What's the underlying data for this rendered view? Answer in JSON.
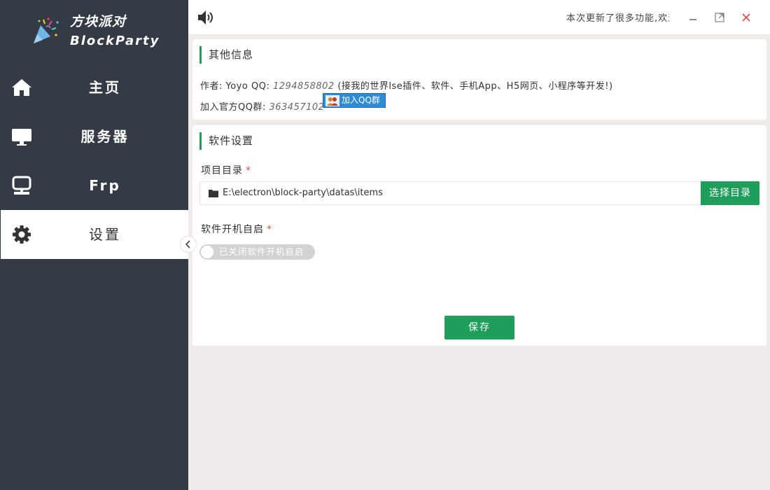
{
  "app": {
    "logo_cn": "方块派对",
    "logo_en": "BlockParty"
  },
  "sidebar": {
    "items": [
      {
        "label": "主页",
        "icon": "home-icon"
      },
      {
        "label": "服务器",
        "icon": "monitor-icon"
      },
      {
        "label": "Frp",
        "icon": "computer-icon"
      },
      {
        "label": "设置",
        "icon": "gear-icon",
        "active": true
      }
    ]
  },
  "topbar": {
    "marquee": "本次更新了很多功能,欢迎"
  },
  "info": {
    "title": "其他信息",
    "author_label": "作者: ",
    "author_name": "Yoyo",
    "qq_label": "QQ: ",
    "qq_number": "1294858802",
    "note": "(接我的世界lse插件、软件、手机App、H5网页、小程序等开发!)",
    "group_label": "加入官方QQ群: ",
    "group_number": "363457102",
    "join_button": "加入QQ群"
  },
  "settings": {
    "title": "软件设置",
    "dir_label": "项目目录",
    "dir_value": "E:\\electron\\block-party\\datas\\items",
    "choose_button": "选择目录",
    "autostart_label": "软件开机自启",
    "autostart_toggle_text": "已关闭软件开机自启",
    "autostart_enabled": false,
    "required_mark": "*",
    "save_button": "保存"
  },
  "colors": {
    "sidebar_bg": "#343b44",
    "accent_green": "#1e9e5a",
    "close_red": "#e04848",
    "qq_blue": "#2f8ad6"
  }
}
